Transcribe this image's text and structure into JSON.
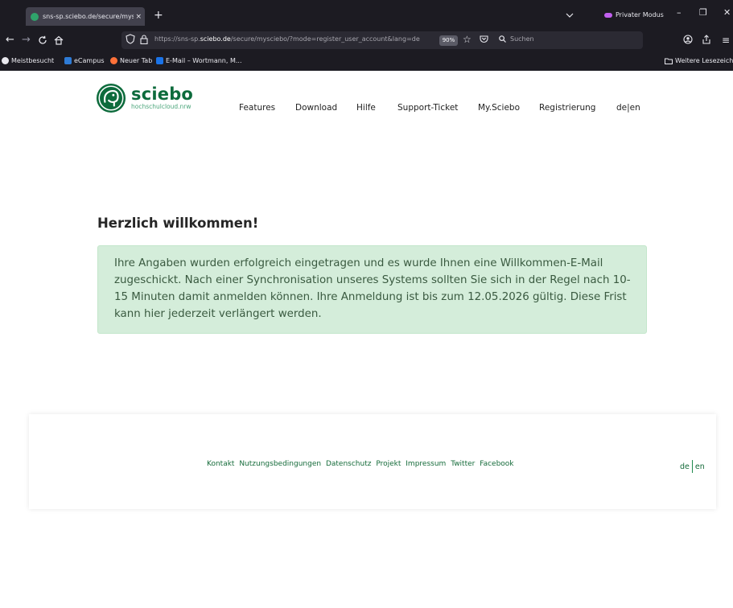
{
  "browser": {
    "tab_title": "sns-sp.sciebo.de/secure/mysciebo",
    "tab_close": "×",
    "new_tab": "+",
    "private_label": "Privater Modus",
    "win_minimize": "–",
    "win_maximize": "❐",
    "win_close": "✕",
    "url": {
      "prefix": "https://sns-sp.",
      "host": "sciebo.de",
      "path": "/secure/mysciebo/?mode=register_user_account&lang=de"
    },
    "zoom": "90%",
    "search_placeholder": "Suchen",
    "bookmarks": [
      {
        "label": "Meistbesucht",
        "color": "#e8e8ee"
      },
      {
        "label": "eCampus",
        "color": "#2e7bd6"
      },
      {
        "label": "Neuer Tab",
        "color": "#ff7139"
      },
      {
        "label": "E-Mail – Wortmann, M...",
        "color": "#1a73e8"
      }
    ],
    "other_bookmarks": "Weitere Lesezeichen"
  },
  "site": {
    "logo_name": "sciebo",
    "logo_sub": "hochschulcloud.nrw",
    "nav": [
      "Features",
      "Download",
      "Hilfe",
      "Support-Ticket",
      "My.Sciebo",
      "Registrierung",
      "de|en"
    ],
    "welcome_title": "Herzlich willkommen!",
    "alert_text": "Ihre Angaben wurden erfolgreich eingetragen und es wurde Ihnen eine Willkommen-E-Mail zugeschickt. Nach einer Synchronisation unseres Systems sollten Sie sich in der Regel nach 10-15 Minuten damit anmelden können. Ihre Anmeldung ist bis zum 12.05.2026 gültig. Diese Frist kann hier jederzeit verlängert werden.",
    "footer_links": [
      "Kontakt",
      "Nutzungsbedingungen",
      "Datenschutz",
      "Projekt",
      "Impressum",
      "Twitter",
      "Facebook"
    ],
    "footer_lang": [
      "de",
      "en"
    ]
  },
  "colors": {
    "brand_green": "#0d6b3c",
    "alert_bg": "#d4edda",
    "alert_text": "#3a5a40",
    "chrome_bg": "#1c1b22",
    "private_purple": "#c160ef"
  }
}
